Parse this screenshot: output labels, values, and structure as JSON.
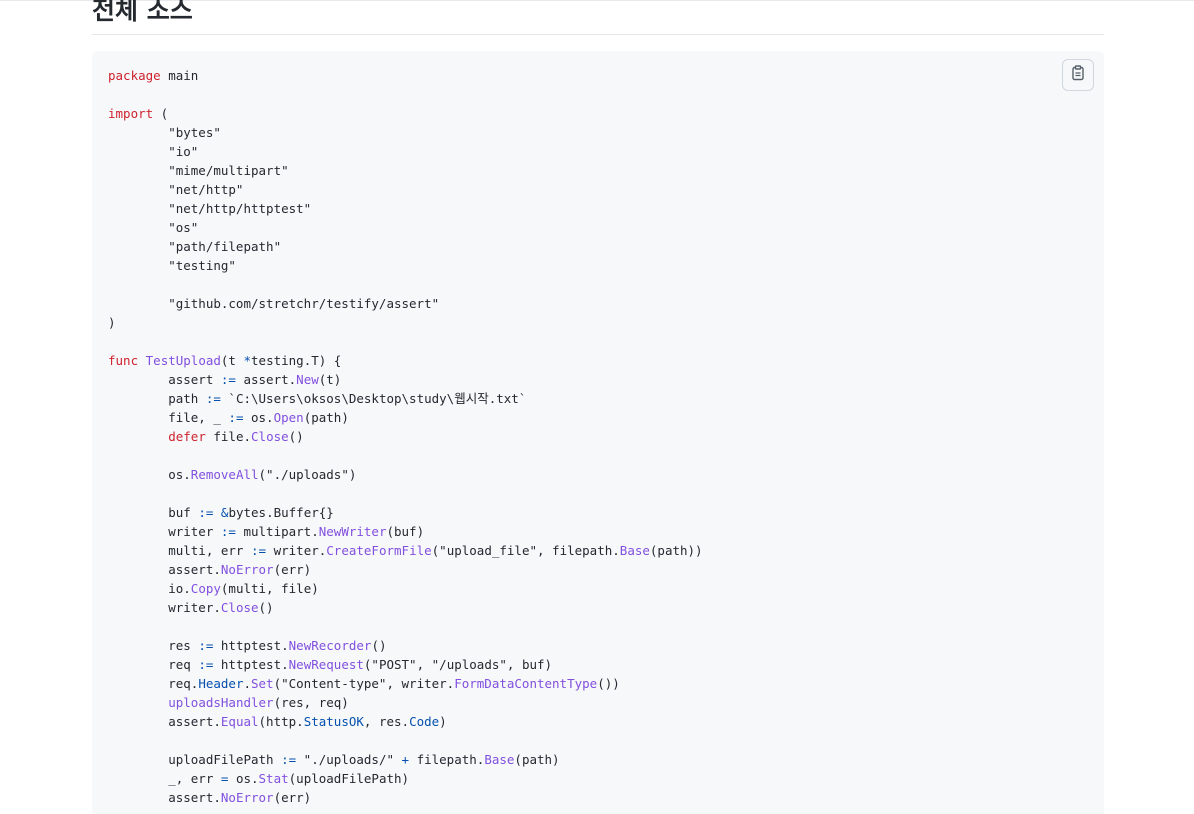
{
  "heading": "전체 소스",
  "copy_button": {
    "icon": "clipboard-icon"
  },
  "code_lines": [
    [
      {
        "k": "kw",
        "t": "package"
      },
      {
        "k": "p",
        "t": " main"
      }
    ],
    [],
    [
      {
        "k": "kw",
        "t": "import"
      },
      {
        "k": "p",
        "t": " ("
      }
    ],
    [
      {
        "k": "p",
        "t": "        \"bytes\""
      }
    ],
    [
      {
        "k": "p",
        "t": "        \"io\""
      }
    ],
    [
      {
        "k": "p",
        "t": "        \"mime/multipart\""
      }
    ],
    [
      {
        "k": "p",
        "t": "        \"net/http\""
      }
    ],
    [
      {
        "k": "p",
        "t": "        \"net/http/httptest\""
      }
    ],
    [
      {
        "k": "p",
        "t": "        \"os\""
      }
    ],
    [
      {
        "k": "p",
        "t": "        \"path/filepath\""
      }
    ],
    [
      {
        "k": "p",
        "t": "        \"testing\""
      }
    ],
    [],
    [
      {
        "k": "p",
        "t": "        \"github.com/stretchr/testify/assert\""
      }
    ],
    [
      {
        "k": "p",
        "t": ")"
      }
    ],
    [],
    [
      {
        "k": "kw",
        "t": "func"
      },
      {
        "k": "p",
        "t": " "
      },
      {
        "k": "fn",
        "t": "TestUpload"
      },
      {
        "k": "p",
        "t": "(t "
      },
      {
        "k": "op",
        "t": "*"
      },
      {
        "k": "p",
        "t": "testing.T) {"
      }
    ],
    [
      {
        "k": "p",
        "t": "        assert "
      },
      {
        "k": "op",
        "t": ":="
      },
      {
        "k": "p",
        "t": " assert."
      },
      {
        "k": "fn",
        "t": "New"
      },
      {
        "k": "p",
        "t": "(t)"
      }
    ],
    [
      {
        "k": "p",
        "t": "        path "
      },
      {
        "k": "op",
        "t": ":="
      },
      {
        "k": "p",
        "t": " `C:\\Users\\oksos\\Desktop\\study\\웹시작.txt`"
      }
    ],
    [
      {
        "k": "p",
        "t": "        file, _ "
      },
      {
        "k": "op",
        "t": ":="
      },
      {
        "k": "p",
        "t": " os."
      },
      {
        "k": "fn",
        "t": "Open"
      },
      {
        "k": "p",
        "t": "(path)"
      }
    ],
    [
      {
        "k": "p",
        "t": "        "
      },
      {
        "k": "kw",
        "t": "defer"
      },
      {
        "k": "p",
        "t": " file."
      },
      {
        "k": "fn",
        "t": "Close"
      },
      {
        "k": "p",
        "t": "()"
      }
    ],
    [],
    [
      {
        "k": "p",
        "t": "        os."
      },
      {
        "k": "fn",
        "t": "RemoveAll"
      },
      {
        "k": "p",
        "t": "(\"./uploads\")"
      }
    ],
    [],
    [
      {
        "k": "p",
        "t": "        buf "
      },
      {
        "k": "op",
        "t": ":="
      },
      {
        "k": "p",
        "t": " "
      },
      {
        "k": "op",
        "t": "&"
      },
      {
        "k": "p",
        "t": "bytes.Buffer{}"
      }
    ],
    [
      {
        "k": "p",
        "t": "        writer "
      },
      {
        "k": "op",
        "t": ":="
      },
      {
        "k": "p",
        "t": " multipart."
      },
      {
        "k": "fn",
        "t": "NewWriter"
      },
      {
        "k": "p",
        "t": "(buf)"
      }
    ],
    [
      {
        "k": "p",
        "t": "        multi, err "
      },
      {
        "k": "op",
        "t": ":="
      },
      {
        "k": "p",
        "t": " writer."
      },
      {
        "k": "fn",
        "t": "CreateFormFile"
      },
      {
        "k": "p",
        "t": "(\"upload_file\", filepath."
      },
      {
        "k": "fn",
        "t": "Base"
      },
      {
        "k": "p",
        "t": "(path))"
      }
    ],
    [
      {
        "k": "p",
        "t": "        assert."
      },
      {
        "k": "fn",
        "t": "NoError"
      },
      {
        "k": "p",
        "t": "(err)"
      }
    ],
    [
      {
        "k": "p",
        "t": "        io."
      },
      {
        "k": "fn",
        "t": "Copy"
      },
      {
        "k": "p",
        "t": "(multi, file)"
      }
    ],
    [
      {
        "k": "p",
        "t": "        writer."
      },
      {
        "k": "fn",
        "t": "Close"
      },
      {
        "k": "p",
        "t": "()"
      }
    ],
    [],
    [
      {
        "k": "p",
        "t": "        res "
      },
      {
        "k": "op",
        "t": ":="
      },
      {
        "k": "p",
        "t": " httptest."
      },
      {
        "k": "fn",
        "t": "NewRecorder"
      },
      {
        "k": "p",
        "t": "()"
      }
    ],
    [
      {
        "k": "p",
        "t": "        req "
      },
      {
        "k": "op",
        "t": ":="
      },
      {
        "k": "p",
        "t": " httptest."
      },
      {
        "k": "fn",
        "t": "NewRequest"
      },
      {
        "k": "p",
        "t": "(\"POST\", \"/uploads\", buf)"
      }
    ],
    [
      {
        "k": "p",
        "t": "        req."
      },
      {
        "k": "op",
        "t": "Header"
      },
      {
        "k": "p",
        "t": "."
      },
      {
        "k": "fn",
        "t": "Set"
      },
      {
        "k": "p",
        "t": "(\"Content-type\", writer."
      },
      {
        "k": "fn",
        "t": "FormDataContentType"
      },
      {
        "k": "p",
        "t": "())"
      }
    ],
    [
      {
        "k": "p",
        "t": "        "
      },
      {
        "k": "fn",
        "t": "uploadsHandler"
      },
      {
        "k": "p",
        "t": "(res, req)"
      }
    ],
    [
      {
        "k": "p",
        "t": "        assert."
      },
      {
        "k": "fn",
        "t": "Equal"
      },
      {
        "k": "p",
        "t": "(http."
      },
      {
        "k": "op",
        "t": "StatusOK"
      },
      {
        "k": "p",
        "t": ", res."
      },
      {
        "k": "op",
        "t": "Code"
      },
      {
        "k": "p",
        "t": ")"
      }
    ],
    [],
    [
      {
        "k": "p",
        "t": "        uploadFilePath "
      },
      {
        "k": "op",
        "t": ":="
      },
      {
        "k": "p",
        "t": " \"./uploads/\" "
      },
      {
        "k": "op",
        "t": "+"
      },
      {
        "k": "p",
        "t": " filepath."
      },
      {
        "k": "fn",
        "t": "Base"
      },
      {
        "k": "p",
        "t": "(path)"
      }
    ],
    [
      {
        "k": "p",
        "t": "        _, err "
      },
      {
        "k": "op",
        "t": "="
      },
      {
        "k": "p",
        "t": " os."
      },
      {
        "k": "fn",
        "t": "Stat"
      },
      {
        "k": "p",
        "t": "(uploadFilePath)"
      }
    ],
    [
      {
        "k": "p",
        "t": "        assert."
      },
      {
        "k": "fn",
        "t": "NoError"
      },
      {
        "k": "p",
        "t": "(err)"
      }
    ]
  ]
}
